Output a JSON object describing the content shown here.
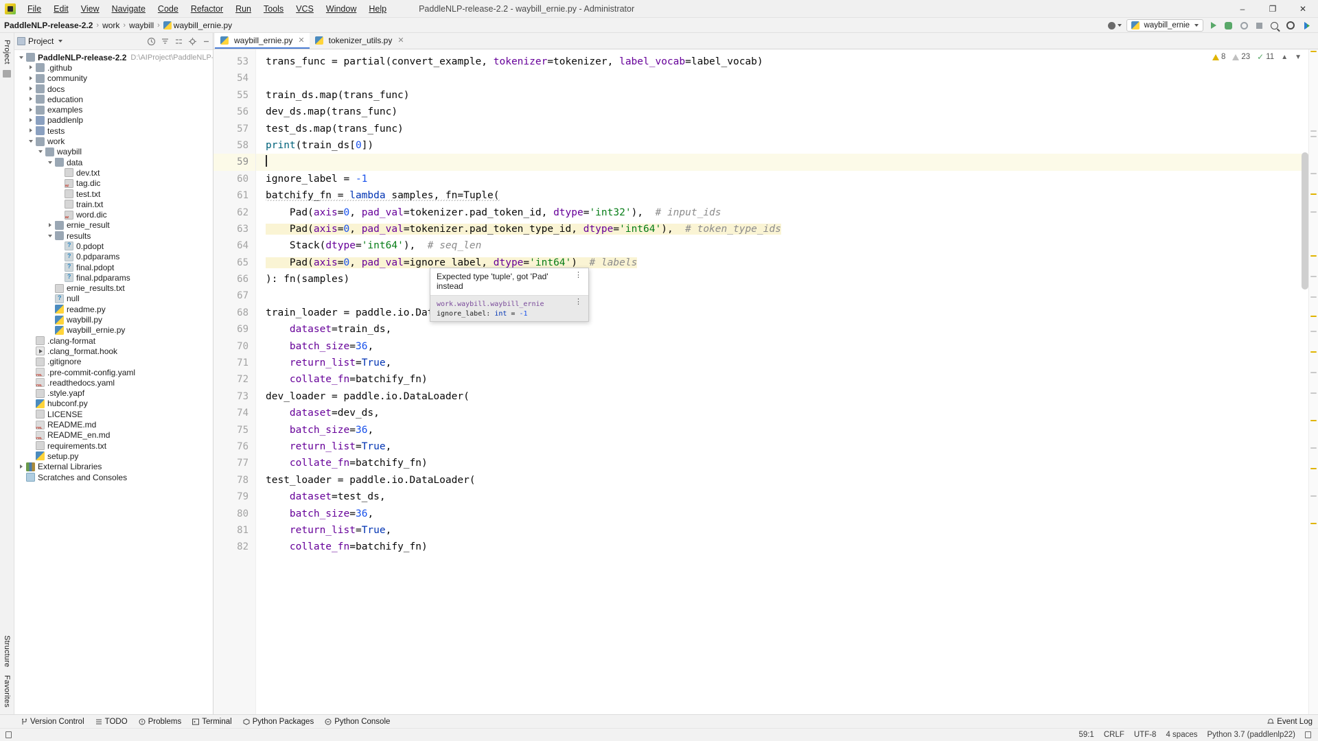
{
  "window": {
    "title": "PaddleNLP-release-2.2 - waybill_ernie.py - Administrator",
    "minimize": "–",
    "maximize": "❐",
    "close": "✕"
  },
  "menubar": [
    {
      "label": "File"
    },
    {
      "label": "Edit"
    },
    {
      "label": "View"
    },
    {
      "label": "Navigate"
    },
    {
      "label": "Code"
    },
    {
      "label": "Refactor"
    },
    {
      "label": "Run"
    },
    {
      "label": "Tools"
    },
    {
      "label": "VCS"
    },
    {
      "label": "Window"
    },
    {
      "label": "Help"
    }
  ],
  "breadcrumb": {
    "items": [
      "PaddleNLP-release-2.2",
      "work",
      "waybill",
      "waybill_ernie.py"
    ],
    "separator": "›"
  },
  "toolbar_right": {
    "run_config": "waybill_ernie",
    "run_tooltip": "Run",
    "debug_tooltip": "Debug",
    "coverage_tooltip": "Run with Coverage",
    "stop_tooltip": "Stop",
    "search_tooltip": "Search Everywhere",
    "settings_tooltip": "Settings",
    "user_tooltip": "Account"
  },
  "left_rail": {
    "top_label": "Project",
    "bottom_labels": [
      "Structure",
      "Favorites"
    ]
  },
  "project_panel": {
    "title": "Project",
    "root": {
      "label": "PaddleNLP-release-2.2",
      "path": "D:\\AIProject\\PaddleNLP-relea"
    },
    "tree": [
      {
        "label": "PaddleNLP-release-2.2",
        "path": "D:\\AIProject\\PaddleNLP-relea",
        "indent": 0,
        "arrow": "down",
        "icon": "folder",
        "bold": true
      },
      {
        "label": ".github",
        "indent": 1,
        "arrow": "right",
        "icon": "folder"
      },
      {
        "label": "community",
        "indent": 1,
        "arrow": "right",
        "icon": "folder"
      },
      {
        "label": "docs",
        "indent": 1,
        "arrow": "right",
        "icon": "folder"
      },
      {
        "label": "education",
        "indent": 1,
        "arrow": "right",
        "icon": "folder"
      },
      {
        "label": "examples",
        "indent": 1,
        "arrow": "right",
        "icon": "folder"
      },
      {
        "label": "paddlenlp",
        "indent": 1,
        "arrow": "right",
        "icon": "folder-src"
      },
      {
        "label": "tests",
        "indent": 1,
        "arrow": "right",
        "icon": "folder-src"
      },
      {
        "label": "work",
        "indent": 1,
        "arrow": "down",
        "icon": "folder"
      },
      {
        "label": "waybill",
        "indent": 2,
        "arrow": "down",
        "icon": "folder"
      },
      {
        "label": "data",
        "indent": 3,
        "arrow": "down",
        "icon": "folder"
      },
      {
        "label": "dev.txt",
        "indent": 4,
        "arrow": "none",
        "icon": "file"
      },
      {
        "label": "tag.dic",
        "indent": 4,
        "arrow": "none",
        "icon": "dic"
      },
      {
        "label": "test.txt",
        "indent": 4,
        "arrow": "none",
        "icon": "file"
      },
      {
        "label": "train.txt",
        "indent": 4,
        "arrow": "none",
        "icon": "file"
      },
      {
        "label": "word.dic",
        "indent": 4,
        "arrow": "none",
        "icon": "dic"
      },
      {
        "label": "ernie_result",
        "indent": 3,
        "arrow": "right",
        "icon": "folder"
      },
      {
        "label": "results",
        "indent": 3,
        "arrow": "down",
        "icon": "folder"
      },
      {
        "label": "0.pdopt",
        "indent": 4,
        "arrow": "none",
        "icon": "unknown"
      },
      {
        "label": "0.pdparams",
        "indent": 4,
        "arrow": "none",
        "icon": "unknown"
      },
      {
        "label": "final.pdopt",
        "indent": 4,
        "arrow": "none",
        "icon": "unknown"
      },
      {
        "label": "final.pdparams",
        "indent": 4,
        "arrow": "none",
        "icon": "unknown"
      },
      {
        "label": "ernie_results.txt",
        "indent": 3,
        "arrow": "none",
        "icon": "file"
      },
      {
        "label": "null",
        "indent": 3,
        "arrow": "none",
        "icon": "unknown"
      },
      {
        "label": "readme.py",
        "indent": 3,
        "arrow": "none",
        "icon": "py"
      },
      {
        "label": "waybill.py",
        "indent": 3,
        "arrow": "none",
        "icon": "py"
      },
      {
        "label": "waybill_ernie.py",
        "indent": 3,
        "arrow": "none",
        "icon": "py"
      },
      {
        "label": ".clang-format",
        "indent": 1,
        "arrow": "none",
        "icon": "file"
      },
      {
        "label": ".clang_format.hook",
        "indent": 1,
        "arrow": "none",
        "icon": "hook"
      },
      {
        "label": ".gitignore",
        "indent": 1,
        "arrow": "none",
        "icon": "file"
      },
      {
        "label": ".pre-commit-config.yaml",
        "indent": 1,
        "arrow": "none",
        "icon": "yaml"
      },
      {
        "label": ".readthedocs.yaml",
        "indent": 1,
        "arrow": "none",
        "icon": "yaml"
      },
      {
        "label": ".style.yapf",
        "indent": 1,
        "arrow": "none",
        "icon": "file"
      },
      {
        "label": "hubconf.py",
        "indent": 1,
        "arrow": "none",
        "icon": "py"
      },
      {
        "label": "LICENSE",
        "indent": 1,
        "arrow": "none",
        "icon": "file"
      },
      {
        "label": "README.md",
        "indent": 1,
        "arrow": "none",
        "icon": "yaml"
      },
      {
        "label": "README_en.md",
        "indent": 1,
        "arrow": "none",
        "icon": "yaml"
      },
      {
        "label": "requirements.txt",
        "indent": 1,
        "arrow": "none",
        "icon": "file"
      },
      {
        "label": "setup.py",
        "indent": 1,
        "arrow": "none",
        "icon": "py"
      },
      {
        "label": "External Libraries",
        "indent": 0,
        "arrow": "right",
        "icon": "lib"
      },
      {
        "label": "Scratches and Consoles",
        "indent": 0,
        "arrow": "none",
        "icon": "scratch"
      }
    ]
  },
  "editor_tabs": [
    {
      "label": "waybill_ernie.py",
      "active": true,
      "close": "✕"
    },
    {
      "label": "tokenizer_utils.py",
      "active": false,
      "close": "✕"
    }
  ],
  "inspection": {
    "errors": "8",
    "warnings": "23",
    "weak_warnings": "11",
    "up_chevron": "▲",
    "down_chevron": "▼"
  },
  "code": {
    "first_line": 53,
    "current_line": 59,
    "lines": [
      {
        "n": 53,
        "tokens": [
          {
            "t": "def",
            "v": "trans_func "
          },
          {
            "t": "def",
            "v": "= "
          },
          {
            "t": "def",
            "v": "partial(convert_example, "
          },
          {
            "t": "par",
            "v": "tokenizer"
          },
          {
            "t": "def",
            "v": "=tokenizer, "
          },
          {
            "t": "par",
            "v": "label_vocab"
          },
          {
            "t": "def",
            "v": "=label_vocab)"
          }
        ]
      },
      {
        "n": 54,
        "tokens": []
      },
      {
        "n": 55,
        "tokens": [
          {
            "t": "def",
            "v": "train_ds.map(trans_func)"
          }
        ]
      },
      {
        "n": 56,
        "tokens": [
          {
            "t": "def",
            "v": "dev_ds.map(trans_func)"
          }
        ]
      },
      {
        "n": 57,
        "tokens": [
          {
            "t": "def",
            "v": "test_ds.map(trans_func)"
          }
        ]
      },
      {
        "n": 58,
        "tokens": [
          {
            "t": "fn",
            "v": "print"
          },
          {
            "t": "def",
            "v": "(train_ds["
          },
          {
            "t": "num",
            "v": "0"
          },
          {
            "t": "def",
            "v": "])"
          }
        ]
      },
      {
        "n": 59,
        "tokens": []
      },
      {
        "n": 60,
        "tokens": [
          {
            "t": "def",
            "v": "ignore_label = "
          },
          {
            "t": "num",
            "v": "-1"
          }
        ]
      },
      {
        "n": 61,
        "tokens": [
          {
            "t": "def",
            "v": "batchify_fn = "
          },
          {
            "t": "kw",
            "v": "lambda"
          },
          {
            "t": "def",
            "v": " samples, "
          },
          {
            "t": "def",
            "v": "fn=Tuple("
          }
        ]
      },
      {
        "n": 62,
        "tokens": [
          {
            "t": "def",
            "v": "    Pad("
          },
          {
            "t": "par",
            "v": "axis"
          },
          {
            "t": "def",
            "v": "="
          },
          {
            "t": "num",
            "v": "0"
          },
          {
            "t": "def",
            "v": ", "
          },
          {
            "t": "par",
            "v": "pad_val"
          },
          {
            "t": "def",
            "v": "=tokenizer.pad_token_id, "
          },
          {
            "t": "par",
            "v": "dtype"
          },
          {
            "t": "def",
            "v": "="
          },
          {
            "t": "str",
            "v": "'int32'"
          },
          {
            "t": "def",
            "v": "),  "
          },
          {
            "t": "cmt",
            "v": "# input_ids"
          }
        ]
      },
      {
        "n": 63,
        "tokens": [
          {
            "t": "def",
            "v": "    Pad("
          },
          {
            "t": "par",
            "v": "axis"
          },
          {
            "t": "def",
            "v": "="
          },
          {
            "t": "num",
            "v": "0"
          },
          {
            "t": "def",
            "v": ", "
          },
          {
            "t": "par",
            "v": "pad_val"
          },
          {
            "t": "def",
            "v": "=tokenizer.pad_token_type_id, "
          },
          {
            "t": "par",
            "v": "dtype"
          },
          {
            "t": "def",
            "v": "="
          },
          {
            "t": "str",
            "v": "'int64'"
          },
          {
            "t": "def",
            "v": "),  "
          },
          {
            "t": "cmt",
            "v": "# token_type_ids"
          }
        ]
      },
      {
        "n": 64,
        "tokens": [
          {
            "t": "def",
            "v": "    Stack("
          },
          {
            "t": "par",
            "v": "dtype"
          },
          {
            "t": "def",
            "v": "="
          },
          {
            "t": "str",
            "v": "'int64'"
          },
          {
            "t": "def",
            "v": "),  "
          },
          {
            "t": "cmt",
            "v": "# seq_len"
          }
        ]
      },
      {
        "n": 65,
        "tokens": [
          {
            "t": "def",
            "v": "    Pad("
          },
          {
            "t": "par",
            "v": "axis"
          },
          {
            "t": "def",
            "v": "="
          },
          {
            "t": "num",
            "v": "0"
          },
          {
            "t": "def",
            "v": ", "
          },
          {
            "t": "par",
            "v": "pad_val"
          },
          {
            "t": "def",
            "v": "=ignore_label, "
          },
          {
            "t": "par",
            "v": "dtype"
          },
          {
            "t": "def",
            "v": "="
          },
          {
            "t": "str",
            "v": "'int64'"
          },
          {
            "t": "def",
            "v": ")  "
          },
          {
            "t": "cmt",
            "v": "# labels"
          }
        ]
      },
      {
        "n": 66,
        "tokens": [
          {
            "t": "def",
            "v": "): fn(samples)"
          }
        ]
      },
      {
        "n": 67,
        "tokens": []
      },
      {
        "n": 68,
        "tokens": [
          {
            "t": "def",
            "v": "train_loader = paddle.io.DataLoader("
          }
        ]
      },
      {
        "n": 69,
        "tokens": [
          {
            "t": "def",
            "v": "    "
          },
          {
            "t": "par",
            "v": "dataset"
          },
          {
            "t": "def",
            "v": "=train_ds,"
          }
        ]
      },
      {
        "n": 70,
        "tokens": [
          {
            "t": "def",
            "v": "    "
          },
          {
            "t": "par",
            "v": "batch_size"
          },
          {
            "t": "def",
            "v": "="
          },
          {
            "t": "num",
            "v": "36"
          },
          {
            "t": "def",
            "v": ","
          }
        ]
      },
      {
        "n": 71,
        "tokens": [
          {
            "t": "def",
            "v": "    "
          },
          {
            "t": "par",
            "v": "return_list"
          },
          {
            "t": "def",
            "v": "="
          },
          {
            "t": "kw",
            "v": "True"
          },
          {
            "t": "def",
            "v": ","
          }
        ]
      },
      {
        "n": 72,
        "tokens": [
          {
            "t": "def",
            "v": "    "
          },
          {
            "t": "par",
            "v": "collate_fn"
          },
          {
            "t": "def",
            "v": "=batchify_fn)"
          }
        ]
      },
      {
        "n": 73,
        "tokens": [
          {
            "t": "def",
            "v": "dev_loader = paddle.io.DataLoader("
          }
        ]
      },
      {
        "n": 74,
        "tokens": [
          {
            "t": "def",
            "v": "    "
          },
          {
            "t": "par",
            "v": "dataset"
          },
          {
            "t": "def",
            "v": "=dev_ds,"
          }
        ]
      },
      {
        "n": 75,
        "tokens": [
          {
            "t": "def",
            "v": "    "
          },
          {
            "t": "par",
            "v": "batch_size"
          },
          {
            "t": "def",
            "v": "="
          },
          {
            "t": "num",
            "v": "36"
          },
          {
            "t": "def",
            "v": ","
          }
        ]
      },
      {
        "n": 76,
        "tokens": [
          {
            "t": "def",
            "v": "    "
          },
          {
            "t": "par",
            "v": "return_list"
          },
          {
            "t": "def",
            "v": "="
          },
          {
            "t": "kw",
            "v": "True"
          },
          {
            "t": "def",
            "v": ","
          }
        ]
      },
      {
        "n": 77,
        "tokens": [
          {
            "t": "def",
            "v": "    "
          },
          {
            "t": "par",
            "v": "collate_fn"
          },
          {
            "t": "def",
            "v": "=batchify_fn)"
          }
        ]
      },
      {
        "n": 78,
        "tokens": [
          {
            "t": "def",
            "v": "test_loader = paddle.io.DataLoader("
          }
        ]
      },
      {
        "n": 79,
        "tokens": [
          {
            "t": "def",
            "v": "    "
          },
          {
            "t": "par",
            "v": "dataset"
          },
          {
            "t": "def",
            "v": "=test_ds,"
          }
        ]
      },
      {
        "n": 80,
        "tokens": [
          {
            "t": "def",
            "v": "    "
          },
          {
            "t": "par",
            "v": "batch_size"
          },
          {
            "t": "def",
            "v": "="
          },
          {
            "t": "num",
            "v": "36"
          },
          {
            "t": "def",
            "v": ","
          }
        ]
      },
      {
        "n": 81,
        "tokens": [
          {
            "t": "def",
            "v": "    "
          },
          {
            "t": "par",
            "v": "return_list"
          },
          {
            "t": "def",
            "v": "="
          },
          {
            "t": "kw",
            "v": "True"
          },
          {
            "t": "def",
            "v": ","
          }
        ]
      },
      {
        "n": 82,
        "tokens": [
          {
            "t": "def",
            "v": "    "
          },
          {
            "t": "par",
            "v": "collate_fn"
          },
          {
            "t": "def",
            "v": "=batchify_fn)"
          }
        ]
      }
    ]
  },
  "tooltip": {
    "message": "Expected type 'tuple', got 'Pad' instead",
    "scope": "work.waybill.waybill_ernie",
    "declaration_name": "ignore_label:",
    "declaration_type": "int",
    "declaration_eq": "=",
    "declaration_value": "-1",
    "menu_glyph": "⋮"
  },
  "bottom_toolbar": [
    {
      "label": "Version Control",
      "icon": "branch-icon"
    },
    {
      "label": "TODO",
      "icon": "list-icon"
    },
    {
      "label": "Problems",
      "icon": "warning-icon"
    },
    {
      "label": "Terminal",
      "icon": "terminal-icon"
    },
    {
      "label": "Python Packages",
      "icon": "package-icon"
    },
    {
      "label": "Python Console",
      "icon": "console-icon"
    }
  ],
  "bottom_toolbar_right": {
    "label": "Event Log",
    "icon": "bell-icon"
  },
  "statusbar": {
    "caret": "59:1",
    "line_sep": "CRLF",
    "encoding": "UTF-8",
    "indent": "4 spaces",
    "interpreter": "Python 3.7 (paddlenlp22)",
    "lock": "lock-icon"
  }
}
